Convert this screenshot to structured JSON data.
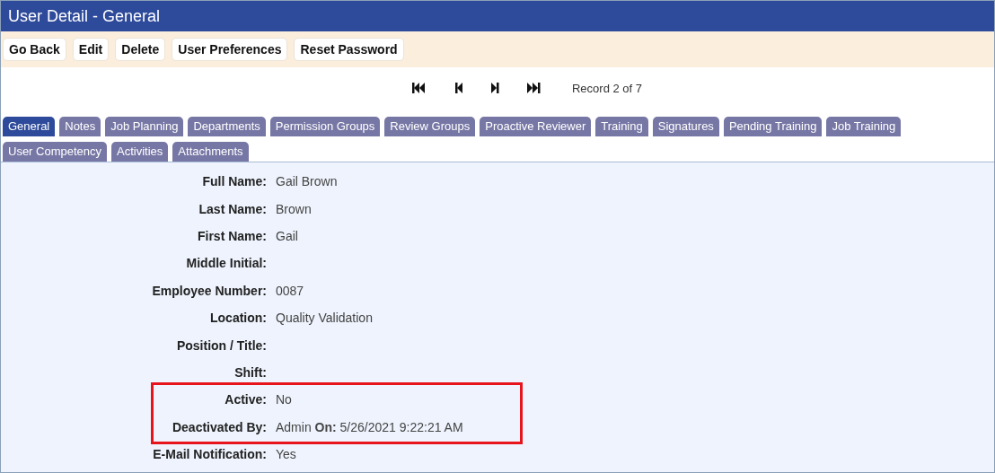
{
  "window": {
    "title": "User Detail - General"
  },
  "toolbar": [
    "Go Back",
    "Edit",
    "Delete",
    "User Preferences",
    "Reset Password"
  ],
  "navigator": {
    "buttons": [
      {
        "kind": "first"
      },
      {
        "kind": "previous"
      },
      {
        "kind": "next"
      },
      {
        "kind": "last"
      }
    ],
    "record": "Record 2 of 7"
  },
  "tabs": [
    {
      "label": "General",
      "selected": true
    },
    {
      "label": "Notes",
      "selected": false
    },
    {
      "label": "Job Planning",
      "selected": false
    },
    {
      "label": "Departments",
      "selected": false
    },
    {
      "label": "Permission Groups",
      "selected": false
    },
    {
      "label": "Review Groups",
      "selected": false
    },
    {
      "label": "Proactive Reviewer",
      "selected": false
    },
    {
      "label": "Training",
      "selected": false
    },
    {
      "label": "Signatures",
      "selected": false
    },
    {
      "label": "Pending Training",
      "selected": false
    },
    {
      "label": "Job Training",
      "selected": false
    },
    {
      "label": "User Competency",
      "selected": false
    },
    {
      "label": "Activities",
      "selected": false
    },
    {
      "label": "Attachments",
      "selected": false
    }
  ],
  "fields": [
    {
      "label": "Full Name:",
      "value": "Gail Brown",
      "highlighted": false
    },
    {
      "label": "Last Name:",
      "value": "Brown",
      "highlighted": false
    },
    {
      "label": "First Name:",
      "value": "Gail",
      "highlighted": false
    },
    {
      "label": "Middle Initial:",
      "highlighted": false
    },
    {
      "label": "Employee Number:",
      "value": "0087",
      "highlighted": false
    },
    {
      "label": "Location:",
      "value": "Quality Validation",
      "highlighted": false
    },
    {
      "label": "Position / Title:",
      "highlighted": false
    },
    {
      "label": "Shift:",
      "highlighted": false
    },
    {
      "label": "Active:",
      "value": "No",
      "highlighted": true
    },
    {
      "label": "Deactivated By:",
      "value": "Admin **On:** 5/26/2021 9:22:21 AM",
      "highlighted": true
    },
    {
      "label": "E-Mail Notification:",
      "value": "Yes",
      "highlighted": false
    }
  ]
}
